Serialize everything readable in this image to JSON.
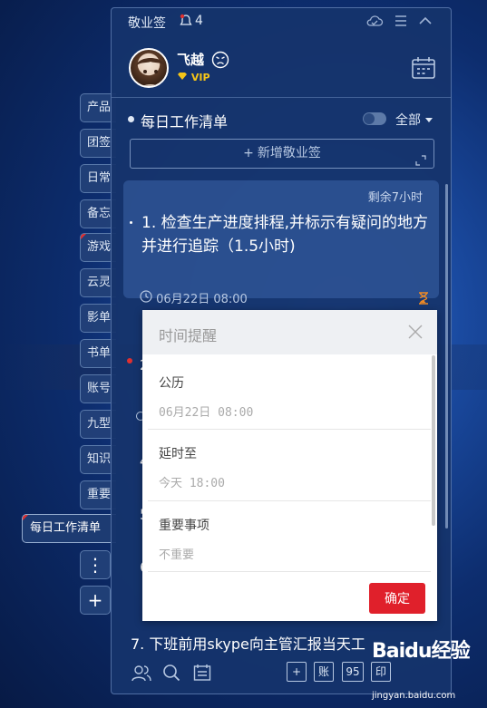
{
  "app": {
    "name": "敬业签",
    "notification_count": "4"
  },
  "user": {
    "name": "飞越",
    "badge": "VIP"
  },
  "side_tabs": [
    {
      "label": "产品",
      "marked": false
    },
    {
      "label": "团签",
      "marked": false
    },
    {
      "label": "日常",
      "marked": false
    },
    {
      "label": "备忘",
      "marked": false
    },
    {
      "label": "游戏",
      "marked": true
    },
    {
      "label": "云灵",
      "marked": false
    },
    {
      "label": "影单",
      "marked": false
    },
    {
      "label": "书单",
      "marked": false
    },
    {
      "label": "账号",
      "marked": false
    },
    {
      "label": "九型",
      "marked": false
    },
    {
      "label": "知识",
      "marked": false
    },
    {
      "label": "重要",
      "marked": false
    }
  ],
  "active_tab": {
    "label": "每日工作清单"
  },
  "side_buttons": {
    "more": "⋮",
    "add": "+"
  },
  "list": {
    "title": "每日工作清单",
    "filter": "全部",
    "add_placeholder": "新增敬业签"
  },
  "note": {
    "remaining": "剩余7小时",
    "title": "1. 检查生产进度排程,并标示有疑问的地方并进行追踪（1.5小时)",
    "time": "06月22日 08:00"
  },
  "partial_items": {
    "n2": "2",
    "n4": "4",
    "n5": "5",
    "n6": "6",
    "n7": "7. 下班前用skype向主管汇报当天工"
  },
  "dialog": {
    "title": "时间提醒",
    "calendar_label": "公历",
    "calendar_value": "06月22日 08:00",
    "delay_label": "延时至",
    "delay_value": "今天 18:00",
    "importance_label": "重要事项",
    "importance_value": "不重要",
    "confirm": "确定"
  },
  "bottom_toolbar": {
    "account": "账",
    "ninety_five": "95",
    "box4": "印"
  },
  "watermark": {
    "brand": "Baidu经验",
    "url": "jingyan.baidu.com"
  },
  "colors": {
    "accent_red": "#e0202b",
    "panel_bg": "#16346c",
    "vip_gold": "#f5c518"
  }
}
